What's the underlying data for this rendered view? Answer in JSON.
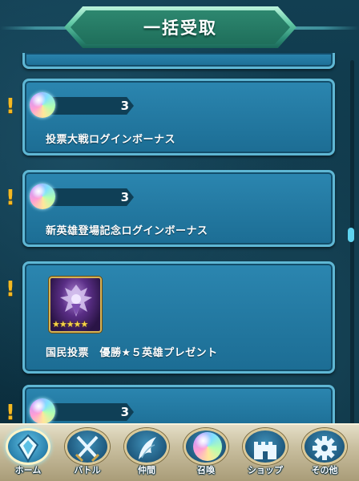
{
  "header": {
    "title": "一括受取"
  },
  "cards": [
    {
      "icon": "orb-icon",
      "count": "3",
      "label": "投票大戦ログインボーナス"
    },
    {
      "icon": "orb-icon",
      "count": "3",
      "label": "新英雄登場記念ログインボーナス"
    },
    {
      "icon": "hero-portrait",
      "stars": "★★★★★",
      "label": "国民投票　優勝★５英雄プレゼント"
    },
    {
      "icon": "orb-icon",
      "count": "3"
    }
  ],
  "alert_mark": "!",
  "nav": [
    {
      "label": "ホーム",
      "icon": "home-icon",
      "active": true
    },
    {
      "label": "バトル",
      "icon": "crossed-swords-icon"
    },
    {
      "label": "仲間",
      "icon": "wing-icon"
    },
    {
      "label": "召喚",
      "icon": "summon-orb-icon"
    },
    {
      "label": "ショップ",
      "icon": "castle-icon"
    },
    {
      "label": "その他",
      "icon": "gear-icon"
    }
  ],
  "colors": {
    "card_bg": "#2b86b0",
    "card_border": "#5fb7d4",
    "alert": "#f5b921",
    "title_plate": "#63c9a6",
    "navbar": "#c9bf9f"
  }
}
